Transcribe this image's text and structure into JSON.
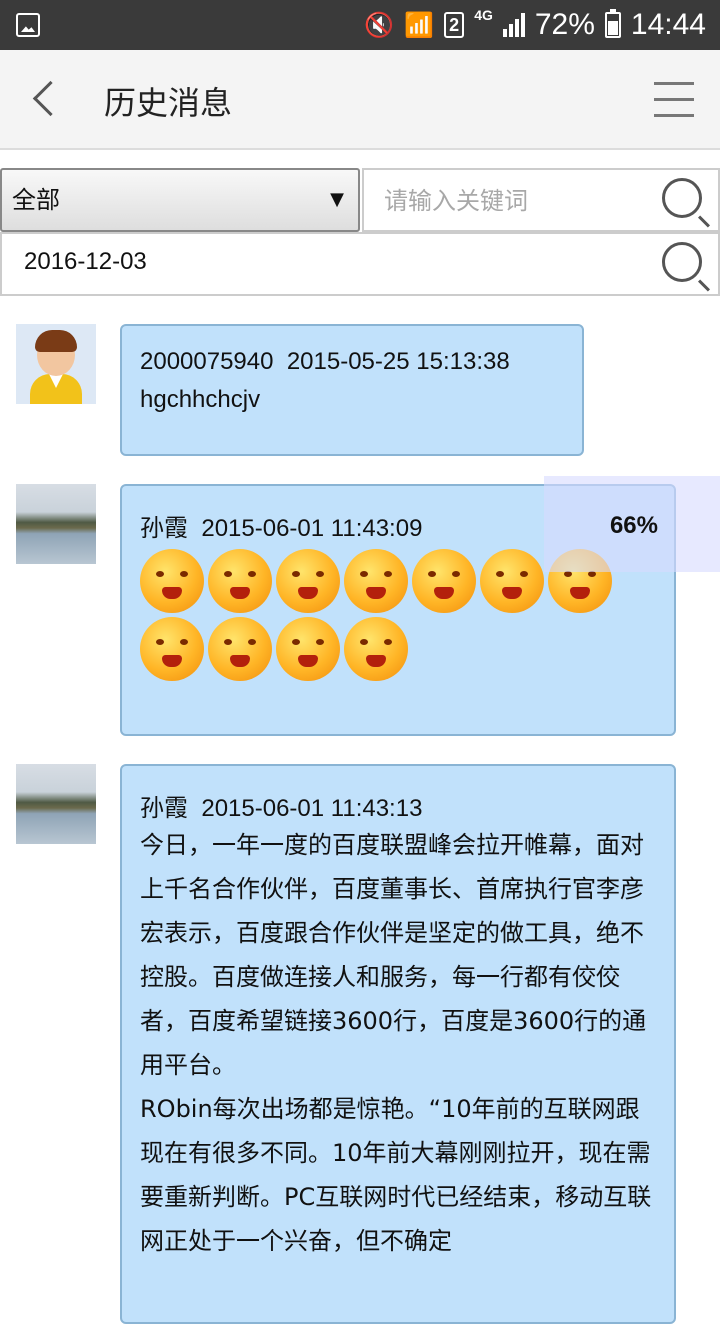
{
  "status_bar": {
    "battery": "72%",
    "time": "14:44",
    "network": "4G",
    "sim": "2"
  },
  "header": {
    "title": "历史消息",
    "back_icon": "chevron-left-icon",
    "menu_icon": "hamburger-menu-icon"
  },
  "filters": {
    "category": "全部",
    "keyword_placeholder": "请输入关键词",
    "keyword_value": "",
    "date": "2016-12-03"
  },
  "messages": [
    {
      "sender": "2000075940",
      "timestamp": "2015-05-25 15:13:38",
      "text": "hgchhchcjv",
      "avatar": "person-avatar"
    },
    {
      "sender": "孙霞",
      "timestamp": "2015-06-01 11:43:09",
      "emoji_count": 10,
      "avatar": "lake-photo-avatar"
    },
    {
      "sender": "孙霞",
      "timestamp": "2015-06-01 11:43:13",
      "paragraphs": [
        "今日，一年一度的百度联盟峰会拉开帷幕，面对上千名合作伙伴，百度董事长、首席执行官李彦宏表示，百度跟合作伙伴是坚定的做工具，绝不控股。百度做连接人和服务，每一行都有佼佼者，百度希望链接3600行，百度是3600行的通用平台。",
        "RObin每次出场都是惊艳。“10年前的互联网跟现在有很多不同。10年前大幕刚刚拉开，现在需要重新判断。PC互联网时代已经结束，移动互联网正处于一个兴奋，但不确定"
      ],
      "avatar": "lake-photo-avatar"
    }
  ],
  "progress_overlay": {
    "label": "66%",
    "value": 0.66
  }
}
